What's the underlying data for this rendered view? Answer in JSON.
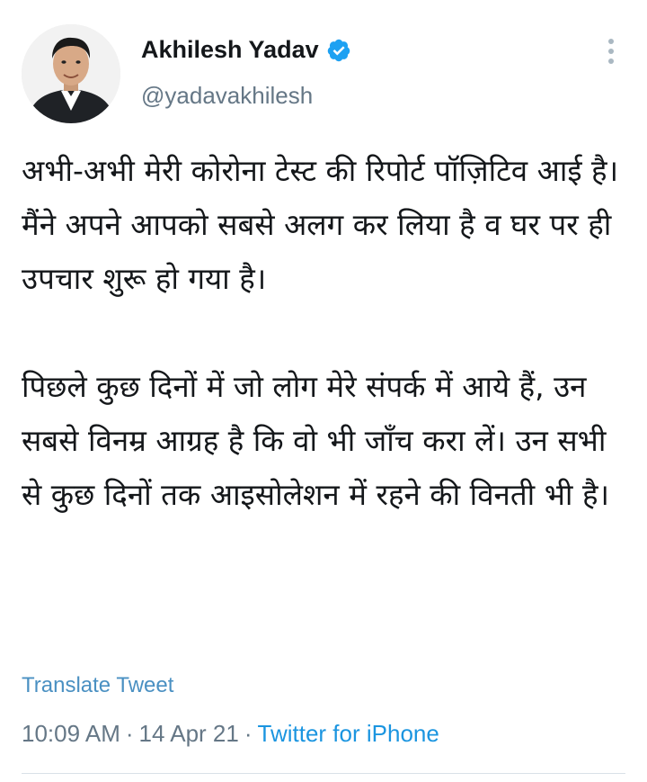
{
  "author": {
    "display_name": "Akhilesh Yadav",
    "handle": "@yadavakhilesh",
    "verified": true
  },
  "icons": {
    "verified": "verified-badge-icon",
    "more": "more-vertical-icon"
  },
  "colors": {
    "link": "#1b95e0",
    "translate": "#4a90c2",
    "muted": "#657786",
    "text": "#14171a",
    "divider": "#d9e1e8"
  },
  "tweet": {
    "paragraph_1": "अभी-अभी मेरी कोरोना टेस्ट की रिपोर्ट पॉज़िटिव आई है। मैंने अपने आपको सबसे अलग कर लिया है व घर पर ही उपचार शुरू हो गया है।",
    "paragraph_2": "पिछले कुछ दिनों में जो लोग मेरे संपर्क में आये हैं, उन सबसे विनम्र आग्रह है कि वो भी जाँच करा लें। उन सभी से कुछ दिनों तक आइसोलेशन में रहने की विनती भी है।"
  },
  "translate_label": "Translate Tweet",
  "meta": {
    "time": "10:09 AM",
    "separator": "·",
    "date": "14 Apr 21",
    "source": "Twitter for iPhone"
  }
}
